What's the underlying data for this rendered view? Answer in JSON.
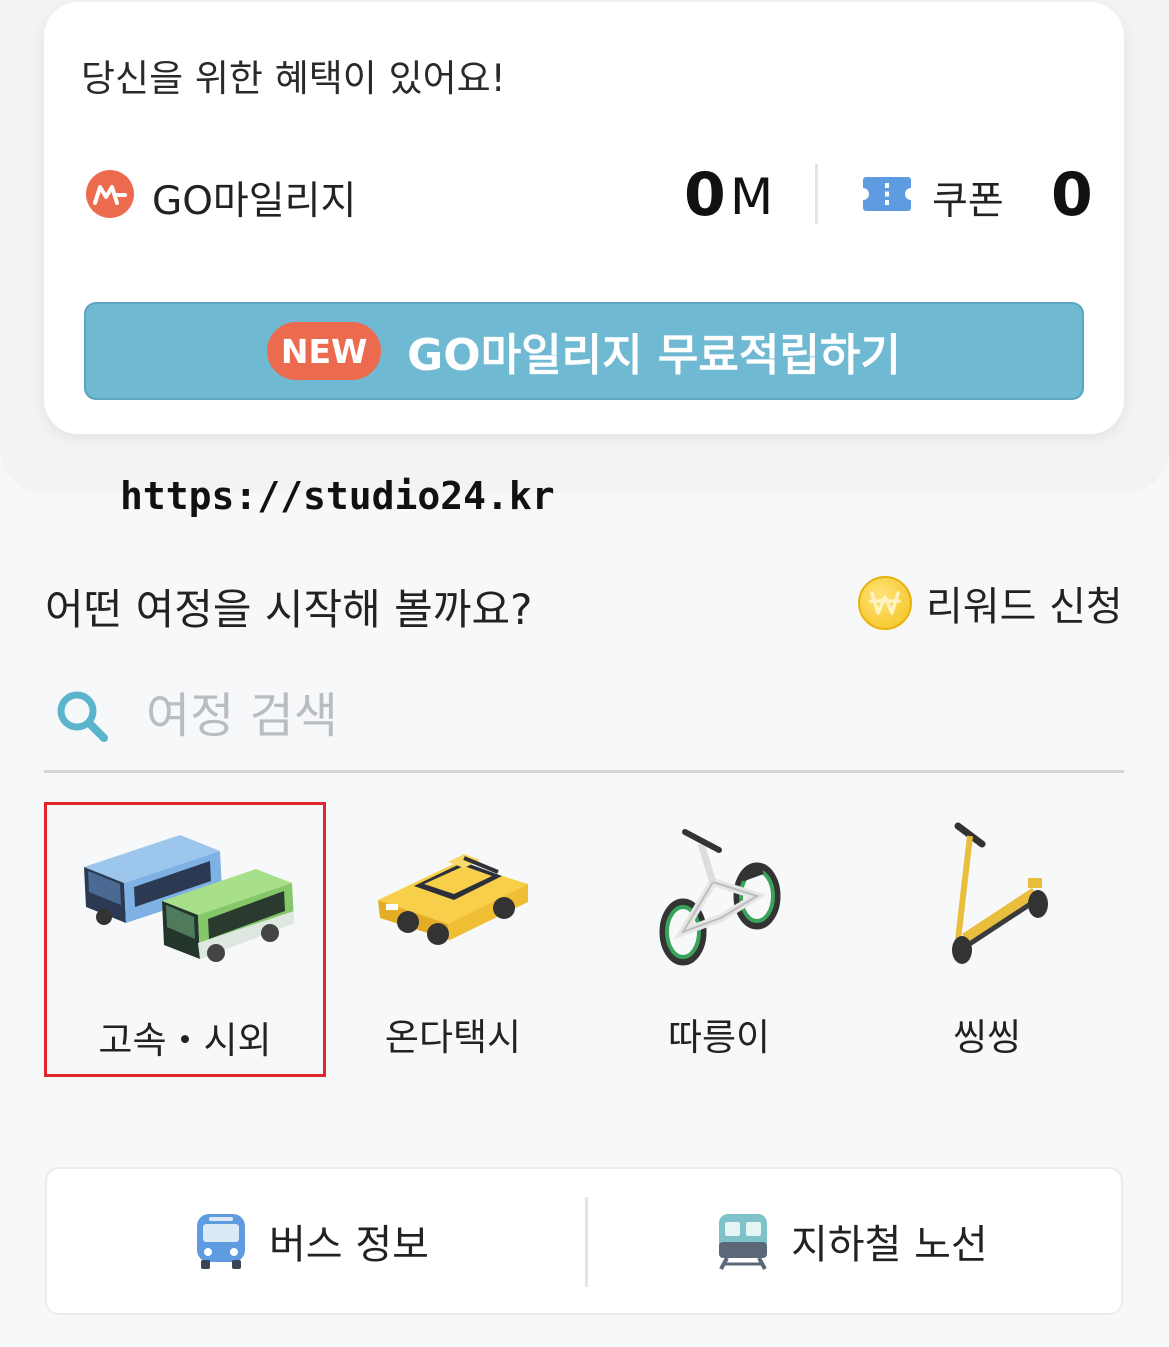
{
  "benefits": {
    "title": "당신을 위한 혜택이 있어요!",
    "mileage": {
      "label": "GO마일리지",
      "value": "0",
      "unit": "M",
      "icon": "mileage-m-icon"
    },
    "coupon": {
      "label": "쿠폰",
      "value": "0",
      "icon": "ticket-icon"
    },
    "cta": {
      "badge": "NEW",
      "label": "GO마일리지 무료적립하기"
    }
  },
  "watermark": "https://studio24.kr",
  "journey": {
    "title": "어떤 여정을 시작해 볼까요?",
    "reward": {
      "label": "리워드 신청",
      "icon": "won-coin-icon"
    },
    "search": {
      "placeholder": "여정 검색",
      "value": "",
      "icon": "search-icon"
    }
  },
  "transport": [
    {
      "label": "고속・시외",
      "icon": "bus-icon",
      "selected": true
    },
    {
      "label": "온다택시",
      "icon": "taxi-icon",
      "selected": false
    },
    {
      "label": "따릉이",
      "icon": "bicycle-icon",
      "selected": false
    },
    {
      "label": "씽씽",
      "icon": "scooter-icon",
      "selected": false
    }
  ],
  "info": [
    {
      "label": "버스 정보",
      "icon": "bus-front-icon"
    },
    {
      "label": "지하철 노선",
      "icon": "subway-icon"
    }
  ],
  "colors": {
    "accent": "#ec6a4e",
    "cta_bg": "#6fb9d3",
    "selection_border": "#e3262c",
    "coupon_blue": "#5e9be0"
  }
}
